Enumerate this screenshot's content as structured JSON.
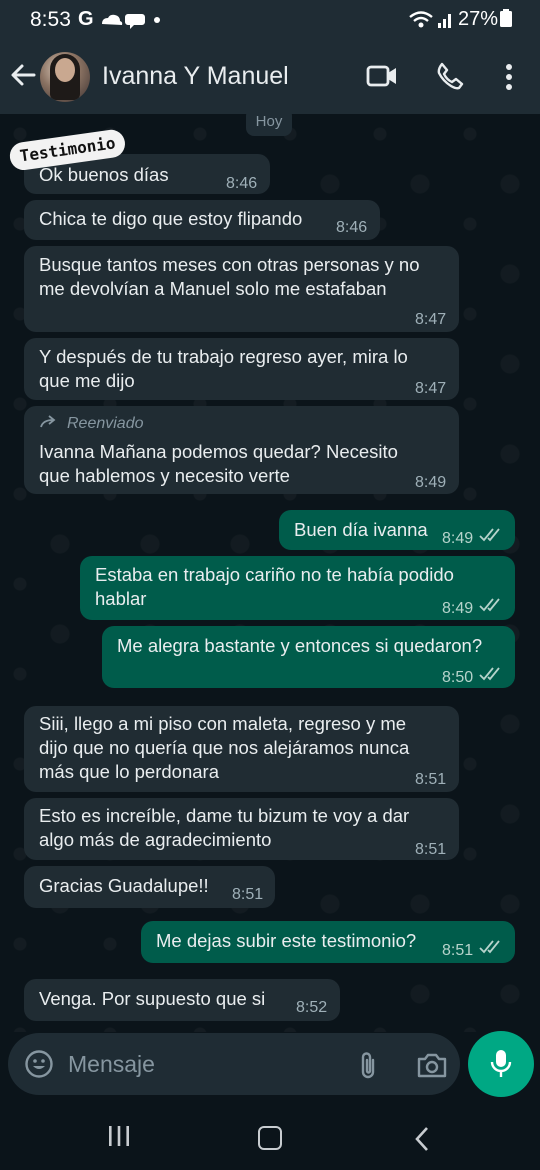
{
  "status_bar": {
    "time": "8:53",
    "g": "G",
    "battery": "27%"
  },
  "header": {
    "contact_name": "Ivanna Y Manuel"
  },
  "date_chip": "Hoy",
  "overlay_badge": "Testimonio",
  "messages": [
    {
      "dir": "in",
      "text": "Ok buenos días",
      "time": "8:46"
    },
    {
      "dir": "in",
      "text": "Chica te digo que estoy flipando",
      "time": "8:46"
    },
    {
      "dir": "in",
      "line1": "Busque tantos meses con otras personas y no",
      "line2": "me devolvían a Manuel solo me estafaban",
      "time": "8:47"
    },
    {
      "dir": "in",
      "line1": "Y después de tu trabajo regreso ayer, mira lo",
      "line2": "que me dijo",
      "time": "8:47"
    },
    {
      "dir": "in",
      "forwarded": "Reenviado",
      "line1": "Ivanna Mañana  podemos quedar? Necesito",
      "line2": "que hablemos y necesito verte",
      "time": "8:49"
    },
    {
      "dir": "out",
      "text": "Buen día ivanna",
      "time": "8:49"
    },
    {
      "dir": "out",
      "line1": "Estaba en trabajo cariño no te había podido",
      "line2": "hablar",
      "time": "8:49"
    },
    {
      "dir": "out",
      "text": "Me alegra bastante y entonces si quedaron?",
      "time": "8:50"
    },
    {
      "dir": "in",
      "line1": "Siii, llego a mi piso con maleta, regreso y me",
      "line2": "dijo que no quería que nos alejáramos nunca",
      "line3": "más que lo perdonara",
      "time": "8:51"
    },
    {
      "dir": "in",
      "line1": "Esto es increíble, dame tu bizum te voy a dar",
      "line2": "algo más de agradecimiento",
      "time": "8:51"
    },
    {
      "dir": "in",
      "text": "Gracias Guadalupe!!",
      "time": "8:51"
    },
    {
      "dir": "out",
      "text": "Me dejas subir este testimonio?",
      "time": "8:51"
    },
    {
      "dir": "in",
      "text": "Venga. Por supuesto que si",
      "time": "8:52"
    }
  ],
  "input": {
    "placeholder": "Mensaje"
  },
  "colors": {
    "incoming": "#202c33",
    "outgoing": "#005c4b",
    "accent": "#00a884",
    "background": "#0b141a"
  }
}
